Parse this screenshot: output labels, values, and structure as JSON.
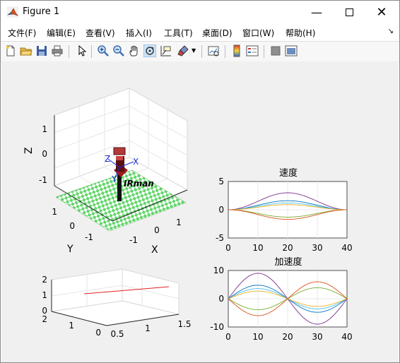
{
  "window": {
    "title": "Figure 1"
  },
  "menu": [
    "文件(F)",
    "编辑(E)",
    "查看(V)",
    "插入(I)",
    "工具(T)",
    "桌面(D)",
    "窗口(W)",
    "帮助(H)"
  ],
  "toolbar": [
    "new-figure-icon",
    "open-icon",
    "save-icon",
    "print-icon",
    "pointer-icon",
    "zoom-in-icon",
    "zoom-out-icon",
    "pan-icon",
    "rotate-3d-icon",
    "data-cursor-icon",
    "brush-icon",
    "link-plot-icon",
    "colorbar-icon",
    "legend-icon",
    "hide-plot-tools-icon",
    "show-plot-tools-icon"
  ],
  "robot_plot": {
    "zlabel": "Z",
    "ylabel": "Y",
    "xlabel": "X",
    "z_ticks": [
      "1",
      "0",
      "-1"
    ],
    "y_ticks": [
      "1",
      "0",
      "-1"
    ],
    "x_ticks": [
      "-1",
      "0",
      "1"
    ],
    "robot_name": "IRman",
    "frame_labels": {
      "x": "X",
      "y": "Y",
      "z": "Z"
    }
  },
  "small_3d_plot": {
    "z_ticks": [
      "2",
      "1",
      "0"
    ],
    "y_ticks": [
      "2",
      "1",
      "0"
    ],
    "x_ticks": [
      "0.5",
      "1",
      "1.5"
    ]
  },
  "chart_data": [
    {
      "type": "line",
      "title": "速度",
      "xlim": [
        0,
        40
      ],
      "ylim": [
        -5,
        5
      ],
      "x_ticks": [
        "0",
        "10",
        "20",
        "30",
        "40"
      ],
      "y_ticks": [
        "5",
        "0",
        "-5"
      ],
      "x": [
        0,
        40
      ],
      "series": [
        {
          "amplitude": 3.0,
          "color": "#7e2f8e",
          "kind": "velocity"
        },
        {
          "amplitude": 1.6,
          "color": "#0072bd",
          "kind": "velocity"
        },
        {
          "amplitude": 1.2,
          "color": "#4dbeee",
          "kind": "velocity"
        },
        {
          "amplitude": 0.9,
          "color": "#edb120",
          "kind": "velocity"
        },
        {
          "amplitude": -1.3,
          "color": "#77ac30",
          "kind": "velocity"
        },
        {
          "amplitude": -1.7,
          "color": "#d95319",
          "kind": "velocity"
        }
      ]
    },
    {
      "type": "line",
      "title": "加速度",
      "xlim": [
        0,
        40
      ],
      "ylim": [
        -10,
        10
      ],
      "x_ticks": [
        "0",
        "10",
        "20",
        "30",
        "40"
      ],
      "y_ticks": [
        "10",
        "0",
        "-10"
      ],
      "x": [
        0,
        40
      ],
      "series": [
        {
          "amplitude": 9.0,
          "color": "#7e2f8e",
          "kind": "acceleration"
        },
        {
          "amplitude": 4.8,
          "color": "#0072bd",
          "kind": "acceleration"
        },
        {
          "amplitude": 3.6,
          "color": "#4dbeee",
          "kind": "acceleration"
        },
        {
          "amplitude": 2.7,
          "color": "#edb120",
          "kind": "acceleration"
        },
        {
          "amplitude": -3.9,
          "color": "#77ac30",
          "kind": "acceleration"
        },
        {
          "amplitude": -6.0,
          "color": "#d95319",
          "kind": "acceleration"
        }
      ]
    }
  ]
}
